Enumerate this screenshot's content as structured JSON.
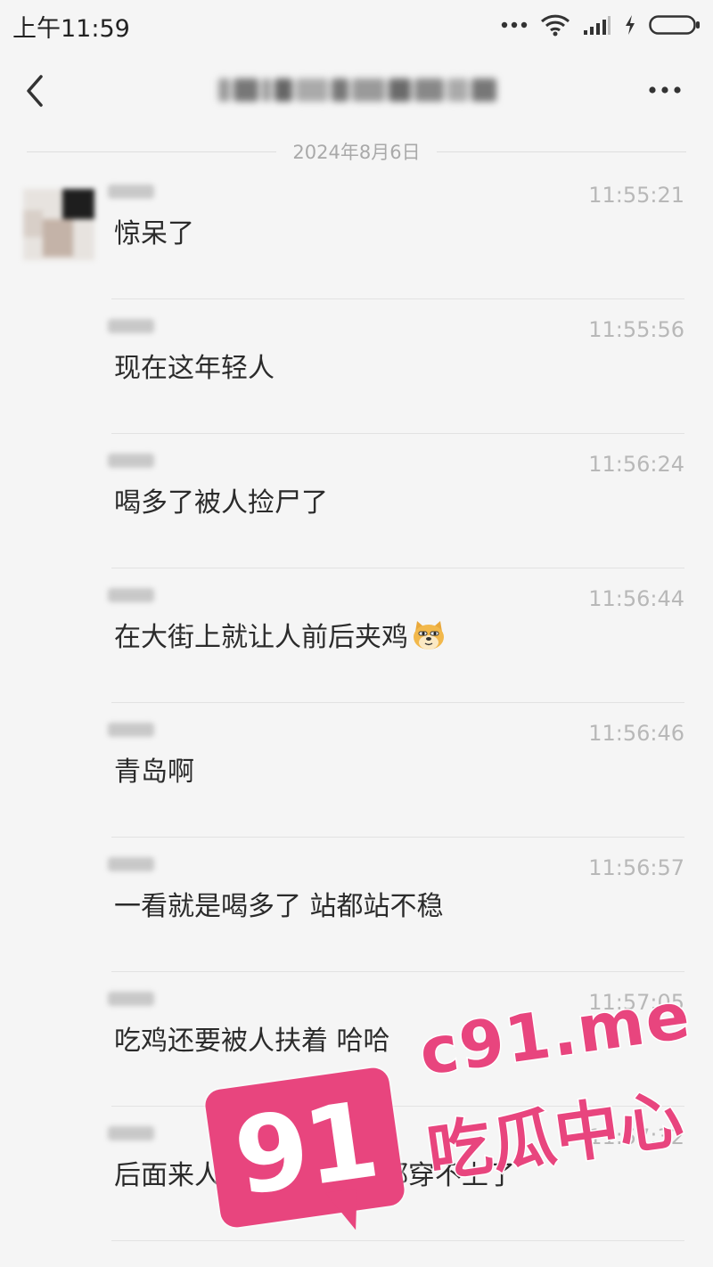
{
  "status_bar": {
    "time": "上午11:59",
    "icons": [
      "more-dots-icon",
      "wifi-icon",
      "signal-icon",
      "charging-icon",
      "battery-icon"
    ]
  },
  "nav": {
    "back_icon": "chevron-left-icon",
    "more_icon": "ellipsis-icon"
  },
  "date_divider": "2024年8月6日",
  "messages": [
    {
      "time": "11:55:21",
      "text": "惊呆了"
    },
    {
      "time": "11:55:56",
      "text": "现在这年轻人"
    },
    {
      "time": "11:56:24",
      "text": "喝多了被人捡尸了"
    },
    {
      "time": "11:56:44",
      "text": "在大街上就让人前后夹鸡",
      "emoji": "doge-emoji-icon"
    },
    {
      "time": "11:56:46",
      "text": "青岛啊"
    },
    {
      "time": "11:56:57",
      "text": "一看就是喝多了 站都站不稳"
    },
    {
      "time": "11:57:05",
      "text": "吃鸡还要被人扶着 哈哈"
    },
    {
      "time": "11:57:32",
      "text": "后面来人了这女的裤子都穿不上了"
    }
  ],
  "watermark": {
    "number": "91",
    "url": "c91.me",
    "text": "吃瓜中心",
    "color": "#e8457e"
  }
}
